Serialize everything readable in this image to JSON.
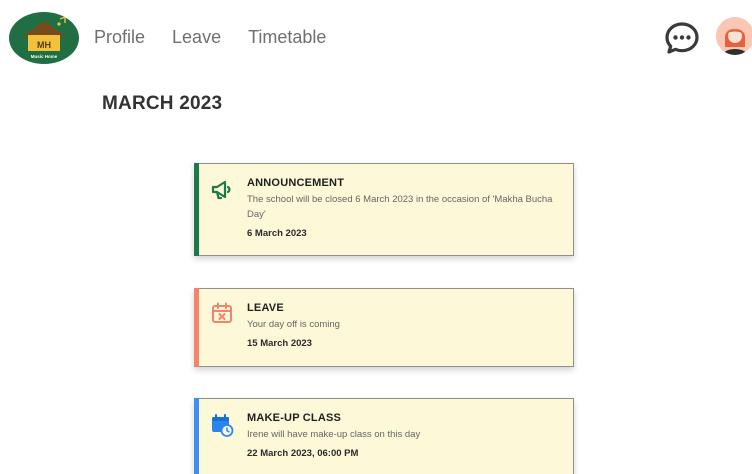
{
  "header": {
    "logo": {
      "initials": "MH",
      "text": "Music Home"
    },
    "nav": [
      {
        "label": "Profile"
      },
      {
        "label": "Leave"
      },
      {
        "label": "Timetable"
      }
    ],
    "icons": {
      "chat": "chat-bubble-icon",
      "avatar": "user-avatar"
    }
  },
  "page": {
    "title": "MARCH 2023"
  },
  "notifications": [
    {
      "type": "announcement",
      "title": "ANNOUNCEMENT",
      "text": "The school will be closed 6 March 2023 in the occasion of  'Makha Bucha Day'",
      "date": "6 March 2023",
      "icon": "megaphone-icon",
      "accent_color": "#1b7a47"
    },
    {
      "type": "leave",
      "title": "LEAVE",
      "text": "Your day off is coming",
      "date": "15 March 2023",
      "icon": "calendar-cancel-icon",
      "accent_color": "#f4846c"
    },
    {
      "type": "makeup",
      "title": "MAKE-UP CLASS",
      "text": "Irene will have make-up class on this day",
      "date": "22 March 2023, 06:00 PM",
      "icon": "calendar-clock-icon",
      "accent_color": "#3d8ff0"
    }
  ],
  "colors": {
    "card_background": "#fdf8d8",
    "logo_green": "#1f6f43"
  }
}
